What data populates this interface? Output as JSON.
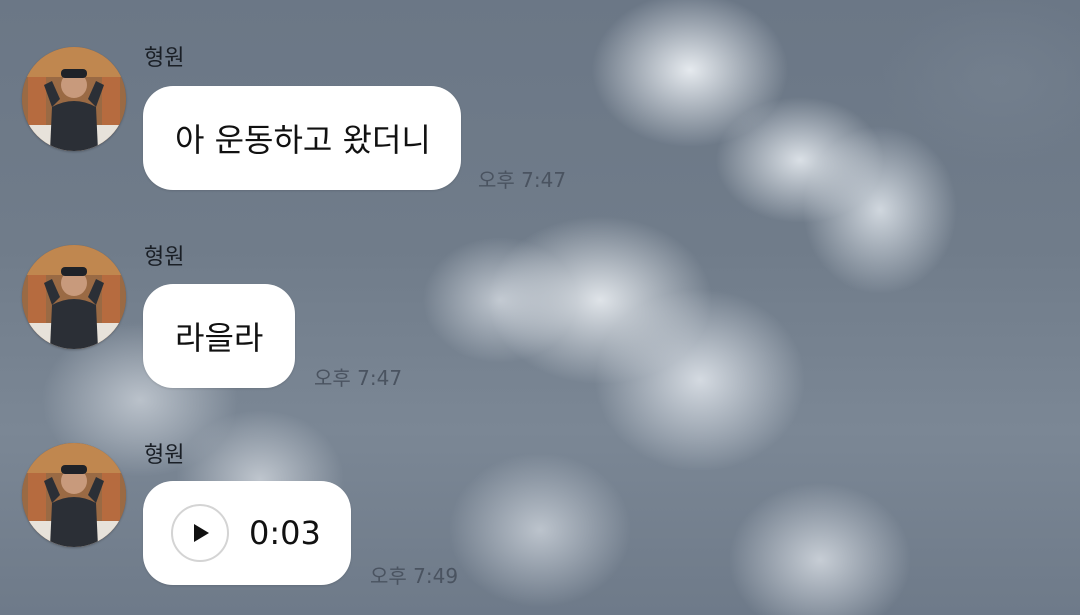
{
  "chat": {
    "messages": [
      {
        "sender": "형원",
        "text": "아 운동하고 왔더니",
        "time": "오후 7:47",
        "avatar_icon": "profile-photo-avatar"
      },
      {
        "sender": "형원",
        "text": "라을라",
        "time": "오후 7:47",
        "avatar_icon": "profile-photo-avatar"
      },
      {
        "sender": "형원",
        "voice_duration": "0:03",
        "play_icon": "play-icon",
        "time": "오후 7:49",
        "avatar_icon": "profile-photo-avatar"
      }
    ]
  },
  "colors": {
    "bubble": "#ffffff",
    "text": "#111111",
    "time_text": "#4a5360",
    "sky_background": "#6d7987"
  }
}
